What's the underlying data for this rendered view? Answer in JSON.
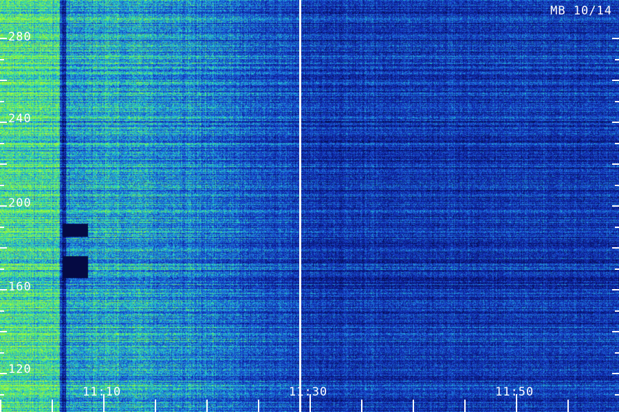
{
  "plot": {
    "station_label": "MB 10/14",
    "y_ticks": [
      "280",
      "240",
      "200",
      "160",
      "120"
    ],
    "x_ticks": [
      "11:10",
      "11:30",
      "11:50"
    ]
  },
  "colors": {
    "background": "#0a1a6e",
    "low": "#0b1f8a",
    "mid": "#1e88d6",
    "high": "#2de0b0",
    "peak": "#8ff040",
    "axis": "#ffffff"
  }
}
